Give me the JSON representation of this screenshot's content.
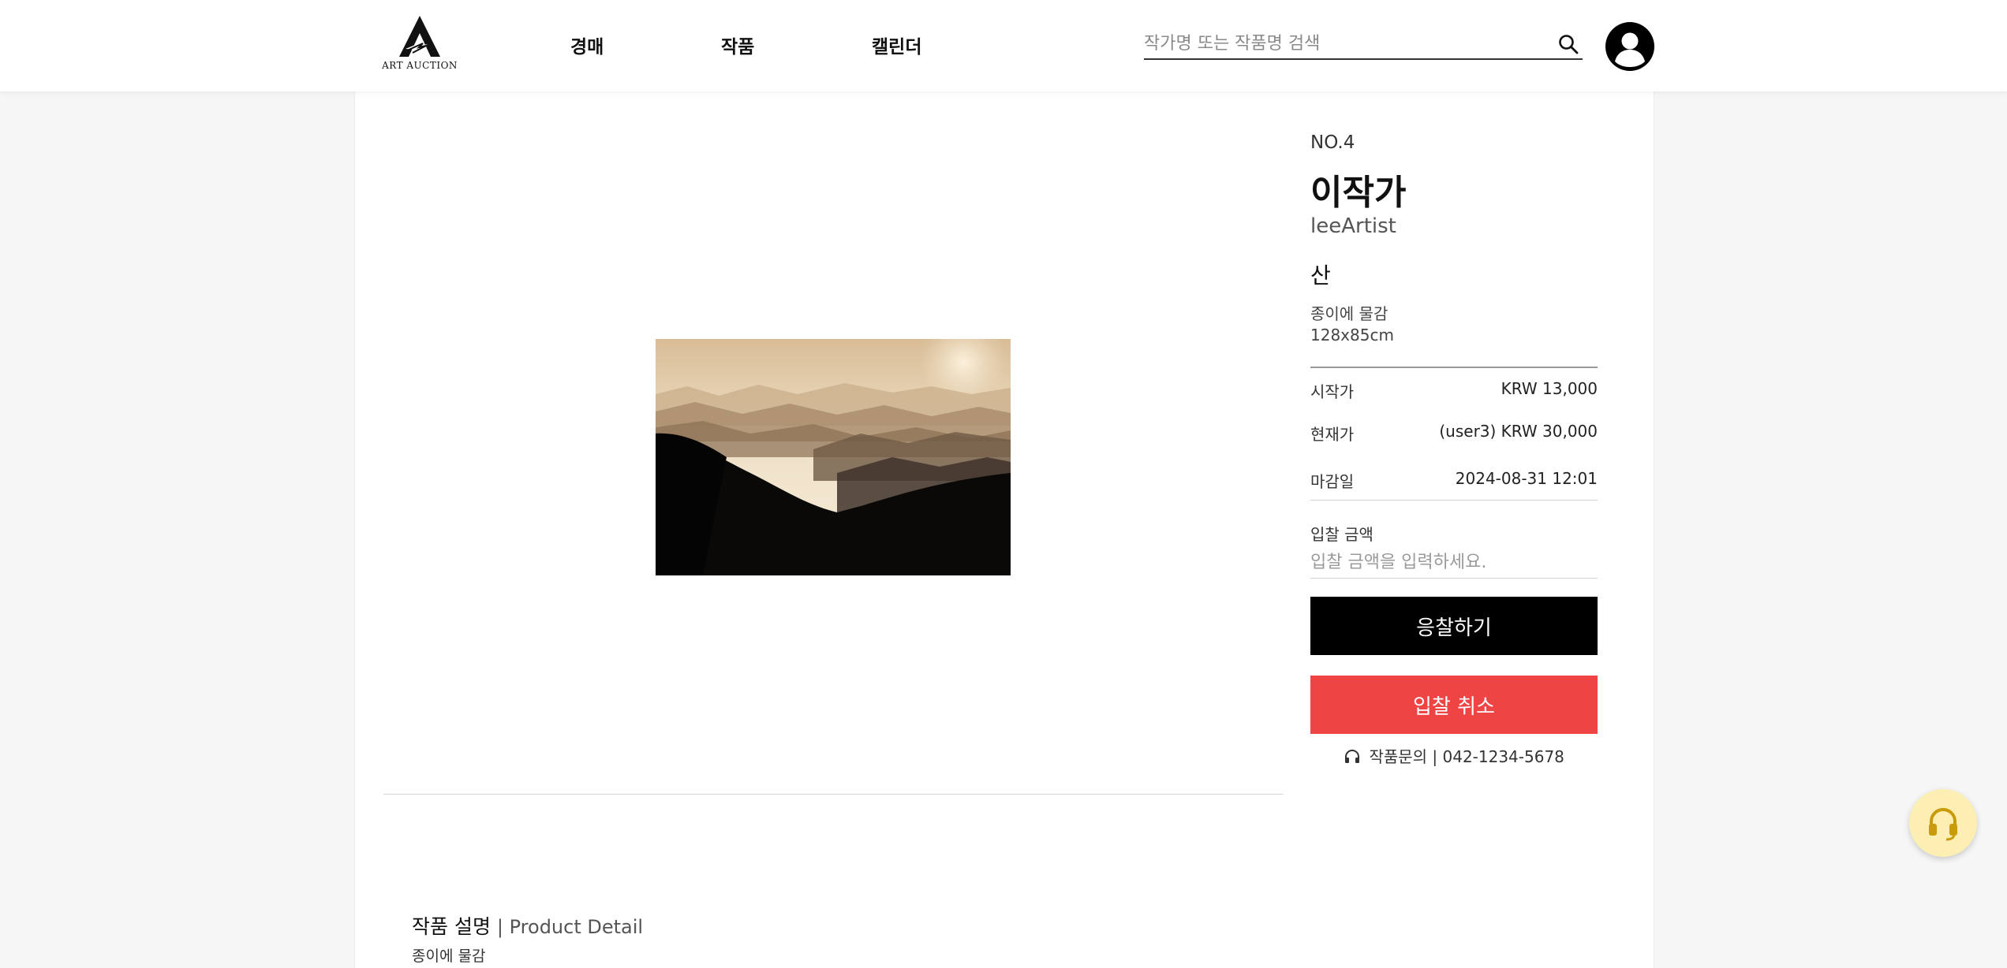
{
  "header": {
    "logo_text": "ART AUCTION",
    "nav": [
      "경매",
      "작품",
      "캘린더"
    ],
    "search_placeholder": "작가명 또는 작품명 검색"
  },
  "artwork": {
    "lot_no": "NO.4",
    "artist_name": "이작가",
    "artist_id": "leeArtist",
    "title": "산",
    "medium": "종이에 물감",
    "size": "128x85cm",
    "image_alt": "산"
  },
  "pricing": {
    "start_label": "시작가",
    "start_value": "KRW 13,000",
    "current_label": "현재가",
    "current_value": "(user3) KRW 30,000",
    "deadline_label": "마감일",
    "deadline_value": "2024-08-31 12:01"
  },
  "bid": {
    "label": "입찰 금액",
    "placeholder": "입찰 금액을 입력하세요.",
    "submit_label": "응찰하기",
    "cancel_label": "입찰 취소"
  },
  "contact": {
    "text": "작품문의 | 042-1234-5678"
  },
  "detail": {
    "title": "작품 설명",
    "subtitle": "| Product Detail",
    "description": "종이에 물감"
  },
  "colors": {
    "bid_button": "#000000",
    "cancel_button": "#ef4444",
    "help_button": "#fdeeb3",
    "help_icon": "#c99a0a"
  },
  "icons": {
    "search": "search-icon",
    "avatar": "user-avatar-icon",
    "contact": "headset-icon",
    "help": "headset-icon"
  }
}
